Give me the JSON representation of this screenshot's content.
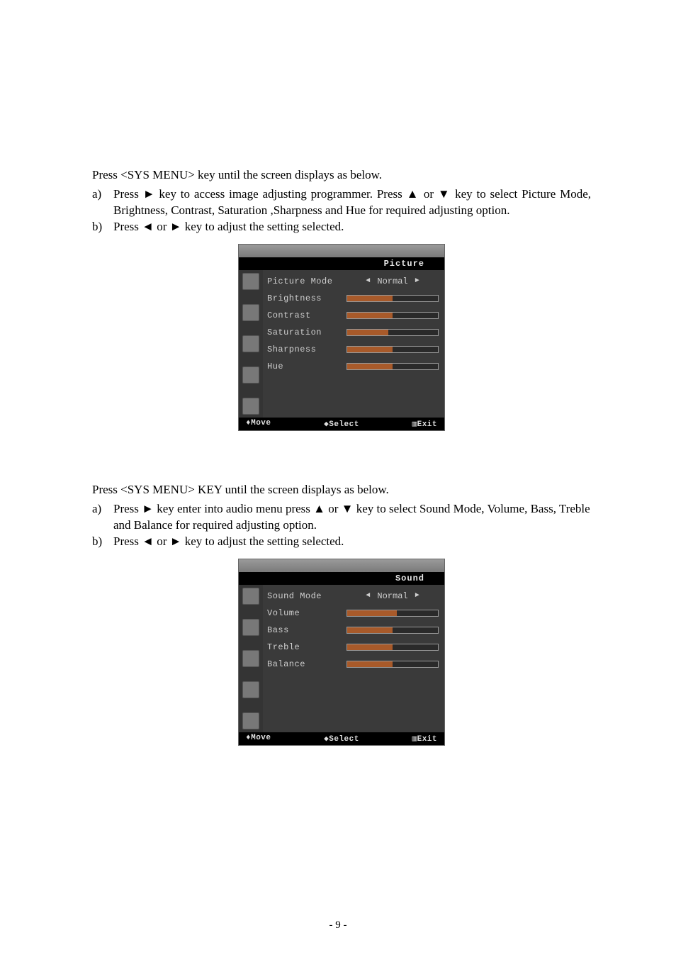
{
  "section_picture": {
    "intro": "Press <SYS MENU> key until the screen displays as below.",
    "item_a_marker": "a)",
    "item_a": "Press ► key to access image adjusting programmer. Press ▲ or ▼ key to select Picture Mode, Brightness, Contrast, Saturation ,Sharpness and Hue for required adjusting option.",
    "item_b_marker": "b)",
    "item_b": "Press ◄ or ► key to adjust the setting selected."
  },
  "osd_picture": {
    "title": "Picture",
    "rows": {
      "mode_label": "Picture Mode",
      "mode_value": "Normal",
      "brightness": "Brightness",
      "contrast": "Contrast",
      "saturation": "Saturation",
      "sharpness": "Sharpness",
      "hue": "Hue"
    },
    "footer": {
      "move": "♦Move",
      "select": "◆Select",
      "exit": "▥Exit"
    }
  },
  "section_sound": {
    "intro": "Press <SYS MENU> KEY until the screen displays as below.",
    "item_a_marker": "a)",
    "item_a": "Press ► key enter into audio menu press ▲ or ▼ key to select Sound Mode, Volume, Bass, Treble and Balance for required adjusting option.",
    "item_b_marker": "b)",
    "item_b": "Press ◄ or ► key to adjust the setting selected."
  },
  "osd_sound": {
    "title": "Sound",
    "rows": {
      "mode_label": "Sound Mode",
      "mode_value": "Normal",
      "volume": "Volume",
      "bass": "Bass",
      "treble": "Treble",
      "balance": "Balance"
    },
    "footer": {
      "move": "♦Move",
      "select": "◆Select",
      "exit": "▥Exit"
    }
  },
  "page_number": "- 9 -",
  "chart_data": [
    {
      "type": "table",
      "title": "Picture OSD menu",
      "rows": [
        {
          "label": "Picture Mode",
          "value": "Normal"
        },
        {
          "label": "Brightness",
          "value_pct": 50
        },
        {
          "label": "Contrast",
          "value_pct": 50
        },
        {
          "label": "Saturation",
          "value_pct": 45
        },
        {
          "label": "Sharpness",
          "value_pct": 50
        },
        {
          "label": "Hue",
          "value_pct": 50
        }
      ]
    },
    {
      "type": "table",
      "title": "Sound OSD menu",
      "rows": [
        {
          "label": "Sound Mode",
          "value": "Normal"
        },
        {
          "label": "Volume",
          "value_pct": 55
        },
        {
          "label": "Bass",
          "value_pct": 50
        },
        {
          "label": "Treble",
          "value_pct": 50
        },
        {
          "label": "Balance",
          "value_pct": 50
        }
      ]
    }
  ]
}
